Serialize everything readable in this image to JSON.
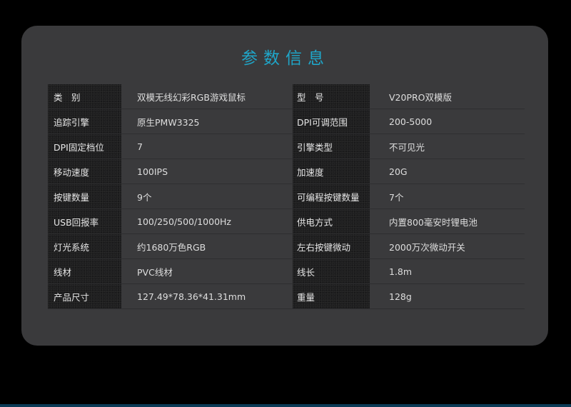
{
  "title": "参数信息",
  "rows": [
    {
      "label1": "类　别",
      "value1": "双模无线幻彩RGB游戏鼠标",
      "label2": "型　号",
      "value2": "V20PRO双模版"
    },
    {
      "label1": "追踪引擎",
      "value1": "原生PMW3325",
      "label2": "DPI可调范围",
      "value2": "200-5000"
    },
    {
      "label1": "DPI固定档位",
      "value1": "7",
      "label2": "引擎类型",
      "value2": "不可见光"
    },
    {
      "label1": "移动速度",
      "value1": "100IPS",
      "label2": "加速度",
      "value2": "20G"
    },
    {
      "label1": "按键数量",
      "value1": "9个",
      "label2": "可编程按键数量",
      "value2": "7个"
    },
    {
      "label1": "USB回报率",
      "value1": "100/250/500/1000Hz",
      "label2": "供电方式",
      "value2": "内置800毫安时锂电池"
    },
    {
      "label1": "灯光系统",
      "value1": "约1680万色RGB",
      "label2": "左右按键微动",
      "value2": "2000万次微动开关"
    },
    {
      "label1": "线材",
      "value1": "PVC线材",
      "label2": "线长",
      "value2": "1.8m"
    },
    {
      "label1": "产品尺寸",
      "value1": "127.49*78.36*41.31mm",
      "label2": "重量",
      "value2": "128g"
    }
  ]
}
